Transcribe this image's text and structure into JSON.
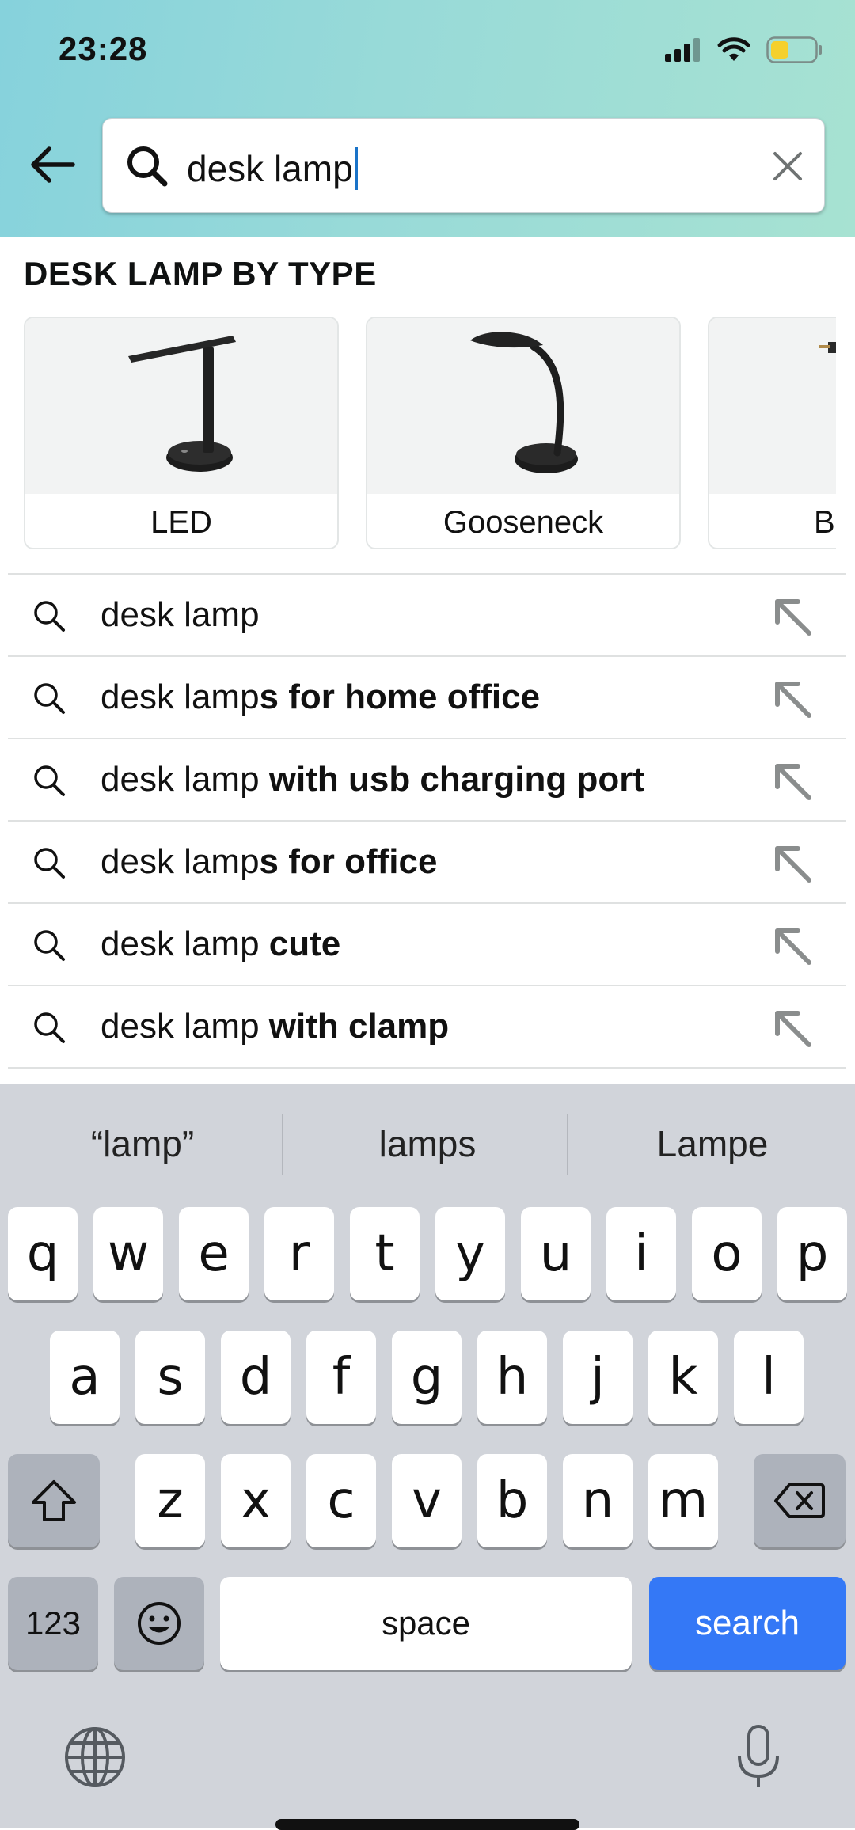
{
  "status_bar": {
    "time": "23:28"
  },
  "search": {
    "query": "desk lamp"
  },
  "type_section": {
    "title": "DESK LAMP BY TYPE",
    "cards": [
      {
        "label": "LED"
      },
      {
        "label": "Gooseneck"
      },
      {
        "label": "Ba"
      }
    ]
  },
  "suggestions": [
    {
      "prefix": "desk lamp",
      "suffix": ""
    },
    {
      "prefix": "desk lamp",
      "suffix": "s for home office"
    },
    {
      "prefix": "desk lamp",
      "suffix": " with usb charging port"
    },
    {
      "prefix": "desk lamp",
      "suffix": "s for office"
    },
    {
      "prefix": "desk lamp",
      "suffix": " cute"
    },
    {
      "prefix": "desk lamp",
      "suffix": " with clamp"
    }
  ],
  "keyboard": {
    "predictions": [
      "“lamp”",
      "lamps",
      "Lampe"
    ],
    "row1": [
      "q",
      "w",
      "e",
      "r",
      "t",
      "y",
      "u",
      "i",
      "o",
      "p"
    ],
    "row2": [
      "a",
      "s",
      "d",
      "f",
      "g",
      "h",
      "j",
      "k",
      "l"
    ],
    "row3": [
      "z",
      "x",
      "c",
      "v",
      "b",
      "n",
      "m"
    ],
    "numbers_label": "123",
    "space_label": "space",
    "search_label": "search"
  },
  "colors": {
    "header_gradient": [
      "#86d2dc",
      "#a7e2d2"
    ],
    "caret": "#1a73c8",
    "search_key": "#3478f6",
    "keyboard_bg": "#d1d4da"
  }
}
